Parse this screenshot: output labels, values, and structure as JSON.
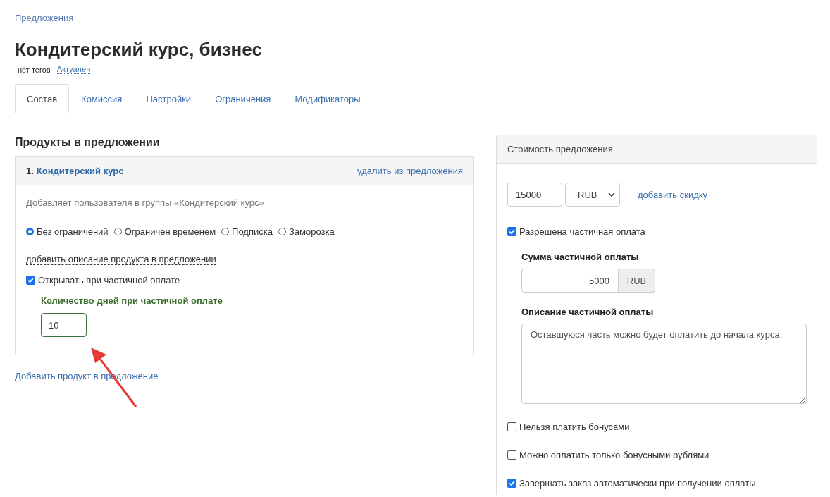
{
  "breadcrumb": "Предложения",
  "title": "Кондитерский курс, бизнес",
  "tags": {
    "label": "нет тегов",
    "status": "Актуален"
  },
  "tabs": [
    {
      "label": "Состав",
      "selected": true
    },
    {
      "label": "Комиссия",
      "selected": false
    },
    {
      "label": "Настройки",
      "selected": false
    },
    {
      "label": "Ограничения",
      "selected": false
    },
    {
      "label": "Модификаторы",
      "selected": false
    }
  ],
  "products": {
    "heading": "Продукты в предложении",
    "items": [
      {
        "number": "1.",
        "name": "Кондитерский курс",
        "remove_link": "удалить из предложения",
        "description": "Добавляет пользователя в группы «Кондитерский курс»",
        "access_options": [
          {
            "label": "Без ограничений",
            "selected": true
          },
          {
            "label": "Ограничен временем",
            "selected": false
          },
          {
            "label": "Подписка",
            "selected": false
          },
          {
            "label": "Заморозка",
            "selected": false
          }
        ],
        "add_description_link": "добавить описание продукта в предложении",
        "open_on_partial": {
          "label": "Открывать при частичной оплате",
          "checked": true
        },
        "days": {
          "label": "Количество дней при частичной оплате",
          "value": "10"
        }
      }
    ],
    "add_product_link": "Добавить продукт в предложение"
  },
  "price": {
    "title": "Стоимость предложения",
    "amount": "15000",
    "currency": "RUB",
    "discount_link": "добавить скидку",
    "partial_payment": {
      "label": "Разрешена частичная оплата",
      "checked": true
    },
    "partial_sum": {
      "label": "Сумма частичной оплаты",
      "value": "5000",
      "currency": "RUB"
    },
    "partial_description": {
      "label": "Описание частичной оплаты",
      "value": "Оставшуюся часть можно будет оплатить до начала курса."
    },
    "options": [
      {
        "label": "Нельзя платить бонусами",
        "checked": false
      },
      {
        "label": "Можно оплатить только бонусными рублями",
        "checked": false
      },
      {
        "label": "Завершать заказ автоматически при получении оплаты",
        "checked": true
      }
    ]
  }
}
